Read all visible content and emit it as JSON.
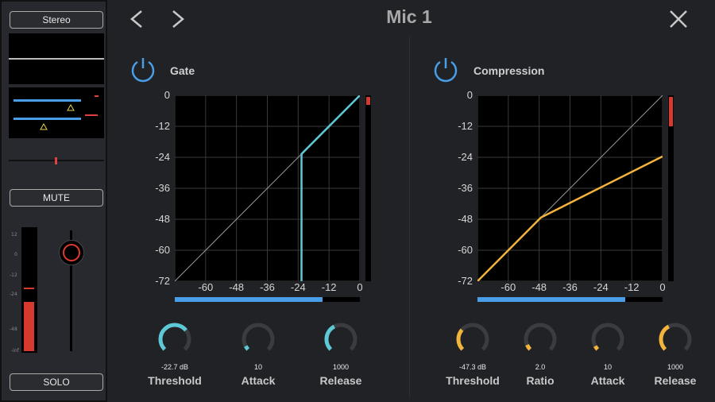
{
  "window": {
    "title": "Mic 1"
  },
  "strip": {
    "stereo_label": "Stereo",
    "mute_label": "MUTE",
    "solo_label": "SOLO",
    "meter_scale": [
      "12",
      "0",
      "-12",
      "-24",
      "-48",
      "-inf"
    ],
    "meter_level": 0.4
  },
  "gate": {
    "title": "Gate",
    "y_ticks": [
      "0",
      "-12",
      "-24",
      "-36",
      "-48",
      "-60",
      "-72"
    ],
    "x_ticks": [
      "-60",
      "-48",
      "-36",
      "-24",
      "-12",
      "0"
    ],
    "curve_color": "#5ec9d6",
    "threshold_db": -22.7,
    "knobs": [
      {
        "value": "-22.7 dB",
        "label": "Threshold",
        "fill": 0.69
      },
      {
        "value": "10",
        "label": "Attack",
        "fill": 0.06
      },
      {
        "value": "1000",
        "label": "Release",
        "fill": 0.4
      }
    ],
    "input_bar": 0.8
  },
  "compression": {
    "title": "Compression",
    "y_ticks": [
      "0",
      "-12",
      "-24",
      "-36",
      "-48",
      "-60",
      "-72"
    ],
    "x_ticks": [
      "-60",
      "-48",
      "-36",
      "-24",
      "-12",
      "0"
    ],
    "curve_color": "#f2b43a",
    "threshold_db": -47.3,
    "ratio": 2.0,
    "knobs": [
      {
        "value": "-47.3  dB",
        "label": "Threshold",
        "fill": 0.32
      },
      {
        "value": "2.0",
        "label": "Ratio",
        "fill": 0.08
      },
      {
        "value": "10",
        "label": "Attack",
        "fill": 0.06
      },
      {
        "value": "1000",
        "label": "Release",
        "fill": 0.4
      }
    ],
    "input_bar": 0.8
  }
}
